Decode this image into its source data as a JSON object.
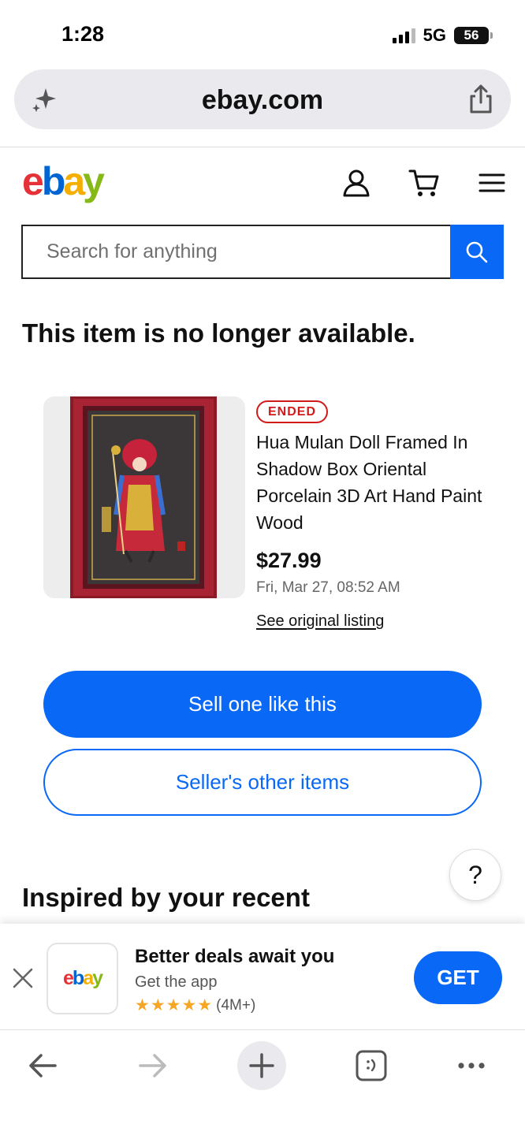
{
  "status_bar": {
    "time": "1:28",
    "network": "5G",
    "battery": "56"
  },
  "browser": {
    "url": "ebay.com"
  },
  "header": {
    "logo": {
      "e": "e",
      "b": "b",
      "a": "a",
      "y": "y"
    }
  },
  "search": {
    "placeholder": "Search for anything"
  },
  "notice": "This item is no longer available.",
  "item": {
    "status": "ENDED",
    "title": "Hua Mulan Doll Framed In Shadow Box Oriental Porcelain 3D Art Hand Paint Wood",
    "price": "$27.99",
    "ended_date": "Fri, Mar 27, 08:52 AM",
    "see_original": "See original listing"
  },
  "actions": {
    "sell_one": "Sell one like this",
    "seller_items": "Seller's other items"
  },
  "help": {
    "label": "?"
  },
  "recommendations": {
    "heading": "Inspired by your recent"
  },
  "app_banner": {
    "title": "Better deals await you",
    "subtitle": "Get the app",
    "stars": "★★★★★",
    "rating_count": "(4M+)",
    "get_label": "GET"
  },
  "colors": {
    "ebay_blue": "#0968f6",
    "ended_red": "#d11a1a",
    "star_gold": "#f5a623"
  },
  "icons": [
    "sparkle-icon",
    "share-icon",
    "account-icon",
    "cart-icon",
    "menu-icon",
    "search-icon",
    "close-icon",
    "back-arrow-icon",
    "forward-arrow-icon",
    "plus-icon",
    "tabs-icon",
    "more-icon"
  ]
}
